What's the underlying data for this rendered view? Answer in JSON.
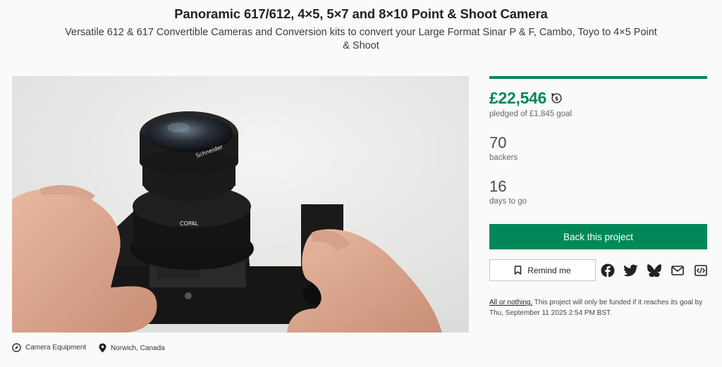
{
  "project": {
    "title": "Panoramic 617/612, 4×5, 5×7 and 8×10 Point & Shoot Camera",
    "subtitle": "Versatile 612 & 617 Convertible Cameras and Conversion kits to convert your Large Format Sinar P & F, Cambo, Toyo to 4×5 Point & Shoot"
  },
  "hero": {
    "alt": "Hands holding a black large format point & shoot camera with a Schneider lens on Copal shutter",
    "lens_text_1": "COPAL",
    "lens_text_2": "Schneider"
  },
  "funding": {
    "pledged": "£22,546",
    "pledged_caption": "pledged of £1,845 goal",
    "progress_fraction": 1.0,
    "currency_icon": "currency-conversion-icon",
    "backers": "70",
    "backers_caption": "backers",
    "days": "16",
    "days_caption": "days to go",
    "accent_color": "#028858"
  },
  "actions": {
    "back_label": "Back this project",
    "remind_label": "Remind me",
    "remind_icon": "bookmark-icon",
    "share_icons": [
      "facebook-icon",
      "twitter-icon",
      "bluesky-icon",
      "email-icon",
      "embed-icon"
    ]
  },
  "all_or_nothing": {
    "link": "All or nothing.",
    "text": " This project will only be funded if it reaches its goal by Thu, September 11 2025 2:54 PM BST."
  },
  "meta": {
    "category": "Camera Equipment",
    "category_icon": "compass-icon",
    "location": "Norwich, Canada",
    "location_icon": "location-pin-icon"
  }
}
